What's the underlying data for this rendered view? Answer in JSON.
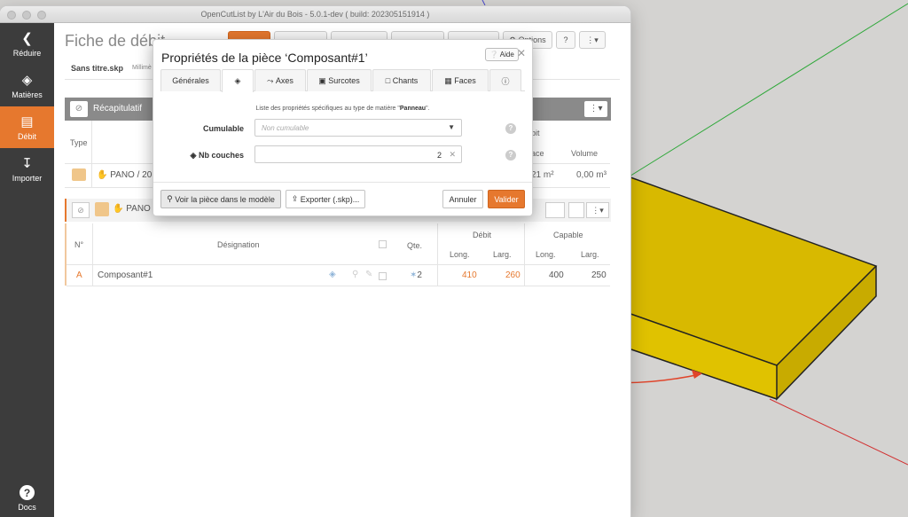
{
  "window": {
    "title": "OpenCutList by L'Air du Bois - 5.0.1-dev ( build: 202305151914 )"
  },
  "sidebar": {
    "items": [
      {
        "label": "Réduire",
        "icon": "chevron-left-icon"
      },
      {
        "label": "Matières",
        "icon": "paint-bucket-icon"
      },
      {
        "label": "Débit",
        "icon": "list-icon",
        "active": true
      },
      {
        "label": "Importer",
        "icon": "import-icon"
      }
    ],
    "docs_label": "Docs"
  },
  "page": {
    "title": "Fiche de débit",
    "file": "Sans titre.skp",
    "unit": "Millimè",
    "toolbar": {
      "options": "Options"
    }
  },
  "summary": {
    "title": "Récapitulatif",
    "col_type": "Type",
    "col_debit": "bit",
    "col_surface": "ace",
    "col_volume": "Volume",
    "row_label": "PANO / 20",
    "row_surface": "21 m²",
    "row_volume": "0,00 m³"
  },
  "group": {
    "label": "PANO",
    "headers": {
      "num": "N°",
      "designation": "Désignation",
      "qty": "Qte.",
      "debit": "Débit",
      "capable": "Capable",
      "long": "Long.",
      "larg": "Larg."
    },
    "rows": [
      {
        "num": "A",
        "designation": "Composant#1",
        "qty": "2",
        "debit_long": "410",
        "debit_larg": "260",
        "cap_long": "400",
        "cap_larg": "250"
      }
    ]
  },
  "modal": {
    "title": "Propriétés de la pièce ‘Composant#1’",
    "help_label": "Aide",
    "tabs": [
      {
        "label": "Générales"
      },
      {
        "label": "",
        "icon": "layers-icon",
        "active": true
      },
      {
        "label": "Axes",
        "icon": "axes-icon"
      },
      {
        "label": "Surcotes",
        "icon": "surcote-icon"
      },
      {
        "label": "Chants",
        "icon": "chants-icon"
      },
      {
        "label": "Faces",
        "icon": "faces-icon"
      },
      {
        "label": "",
        "icon": "info-icon"
      }
    ],
    "description_prefix": "Liste des propriétés spécifiques au type de matière \"",
    "description_material": "Panneau",
    "description_suffix": "\".",
    "fields": {
      "cumulable_label": "Cumulable",
      "cumulable_placeholder": "Non cumulable",
      "layers_label": "Nb couches",
      "layers_value": "2"
    },
    "buttons": {
      "view_model": "Voir la pièce dans le modèle",
      "export": "Exporter (.skp)...",
      "cancel": "Annuler",
      "validate": "Valider"
    }
  },
  "colors": {
    "accent": "#e6782e",
    "sidebar": "#3c3c3c",
    "board": "#e0c000",
    "arrow": "#e0442a"
  }
}
